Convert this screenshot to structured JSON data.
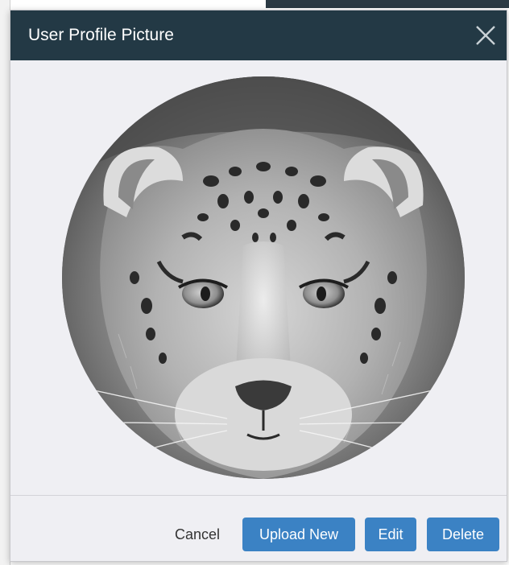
{
  "modal": {
    "title": "User Profile Picture",
    "close_icon": "close-icon",
    "avatar_description_icon": "snow-leopard-photo"
  },
  "footer": {
    "cancel_label": "Cancel",
    "upload_label": "Upload New",
    "edit_label": "Edit",
    "delete_label": "Delete"
  },
  "colors": {
    "header_bg": "#233945",
    "modal_bg": "#efeff3",
    "primary_button": "#3b82c4"
  }
}
